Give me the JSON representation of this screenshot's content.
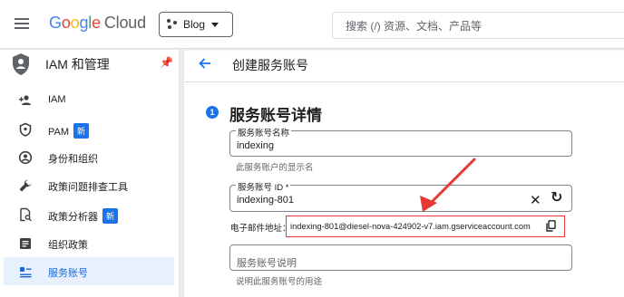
{
  "topbar": {
    "logo": {
      "g1": "G",
      "o1": "o",
      "o2": "o",
      "g2": "g",
      "l": "l",
      "e": "e",
      "product": "Cloud"
    },
    "project": "Blog",
    "search_placeholder": "搜索 (/) 资源、文档、产品等"
  },
  "sidebar": {
    "title": "IAM 和管理",
    "items": [
      {
        "label": "IAM",
        "icon": "person-add-icon"
      },
      {
        "label": "PAM",
        "icon": "shield-icon",
        "badge": "新"
      },
      {
        "label": "身份和组织",
        "icon": "account-circle-icon"
      },
      {
        "label": "政策问题排查工具",
        "icon": "wrench-icon"
      },
      {
        "label": "政策分析器",
        "icon": "document-search-icon",
        "badge": "新"
      },
      {
        "label": "组织政策",
        "icon": "list-box-icon"
      },
      {
        "label": "服务账号",
        "icon": "service-account-icon",
        "active": true
      }
    ]
  },
  "page": {
    "title": "创建服务账号"
  },
  "section": {
    "step": "1",
    "title": "服务账号详情"
  },
  "form": {
    "name_label": "服务账号名称",
    "name_value": "indexing",
    "name_hint": "此服务账户的显示名",
    "id_label": "服务账号 ID *",
    "id_value": "indexing-801",
    "email_label": "电子邮件地址：",
    "email_value": "indexing-801@diesel-nova-424902-v7.iam.gserviceaccount.com",
    "desc_placeholder": "服务账号说明",
    "desc_hint": "说明此服务账号的用途"
  },
  "colors": {
    "accent": "#1a73e8",
    "annotation": "#e53935"
  }
}
